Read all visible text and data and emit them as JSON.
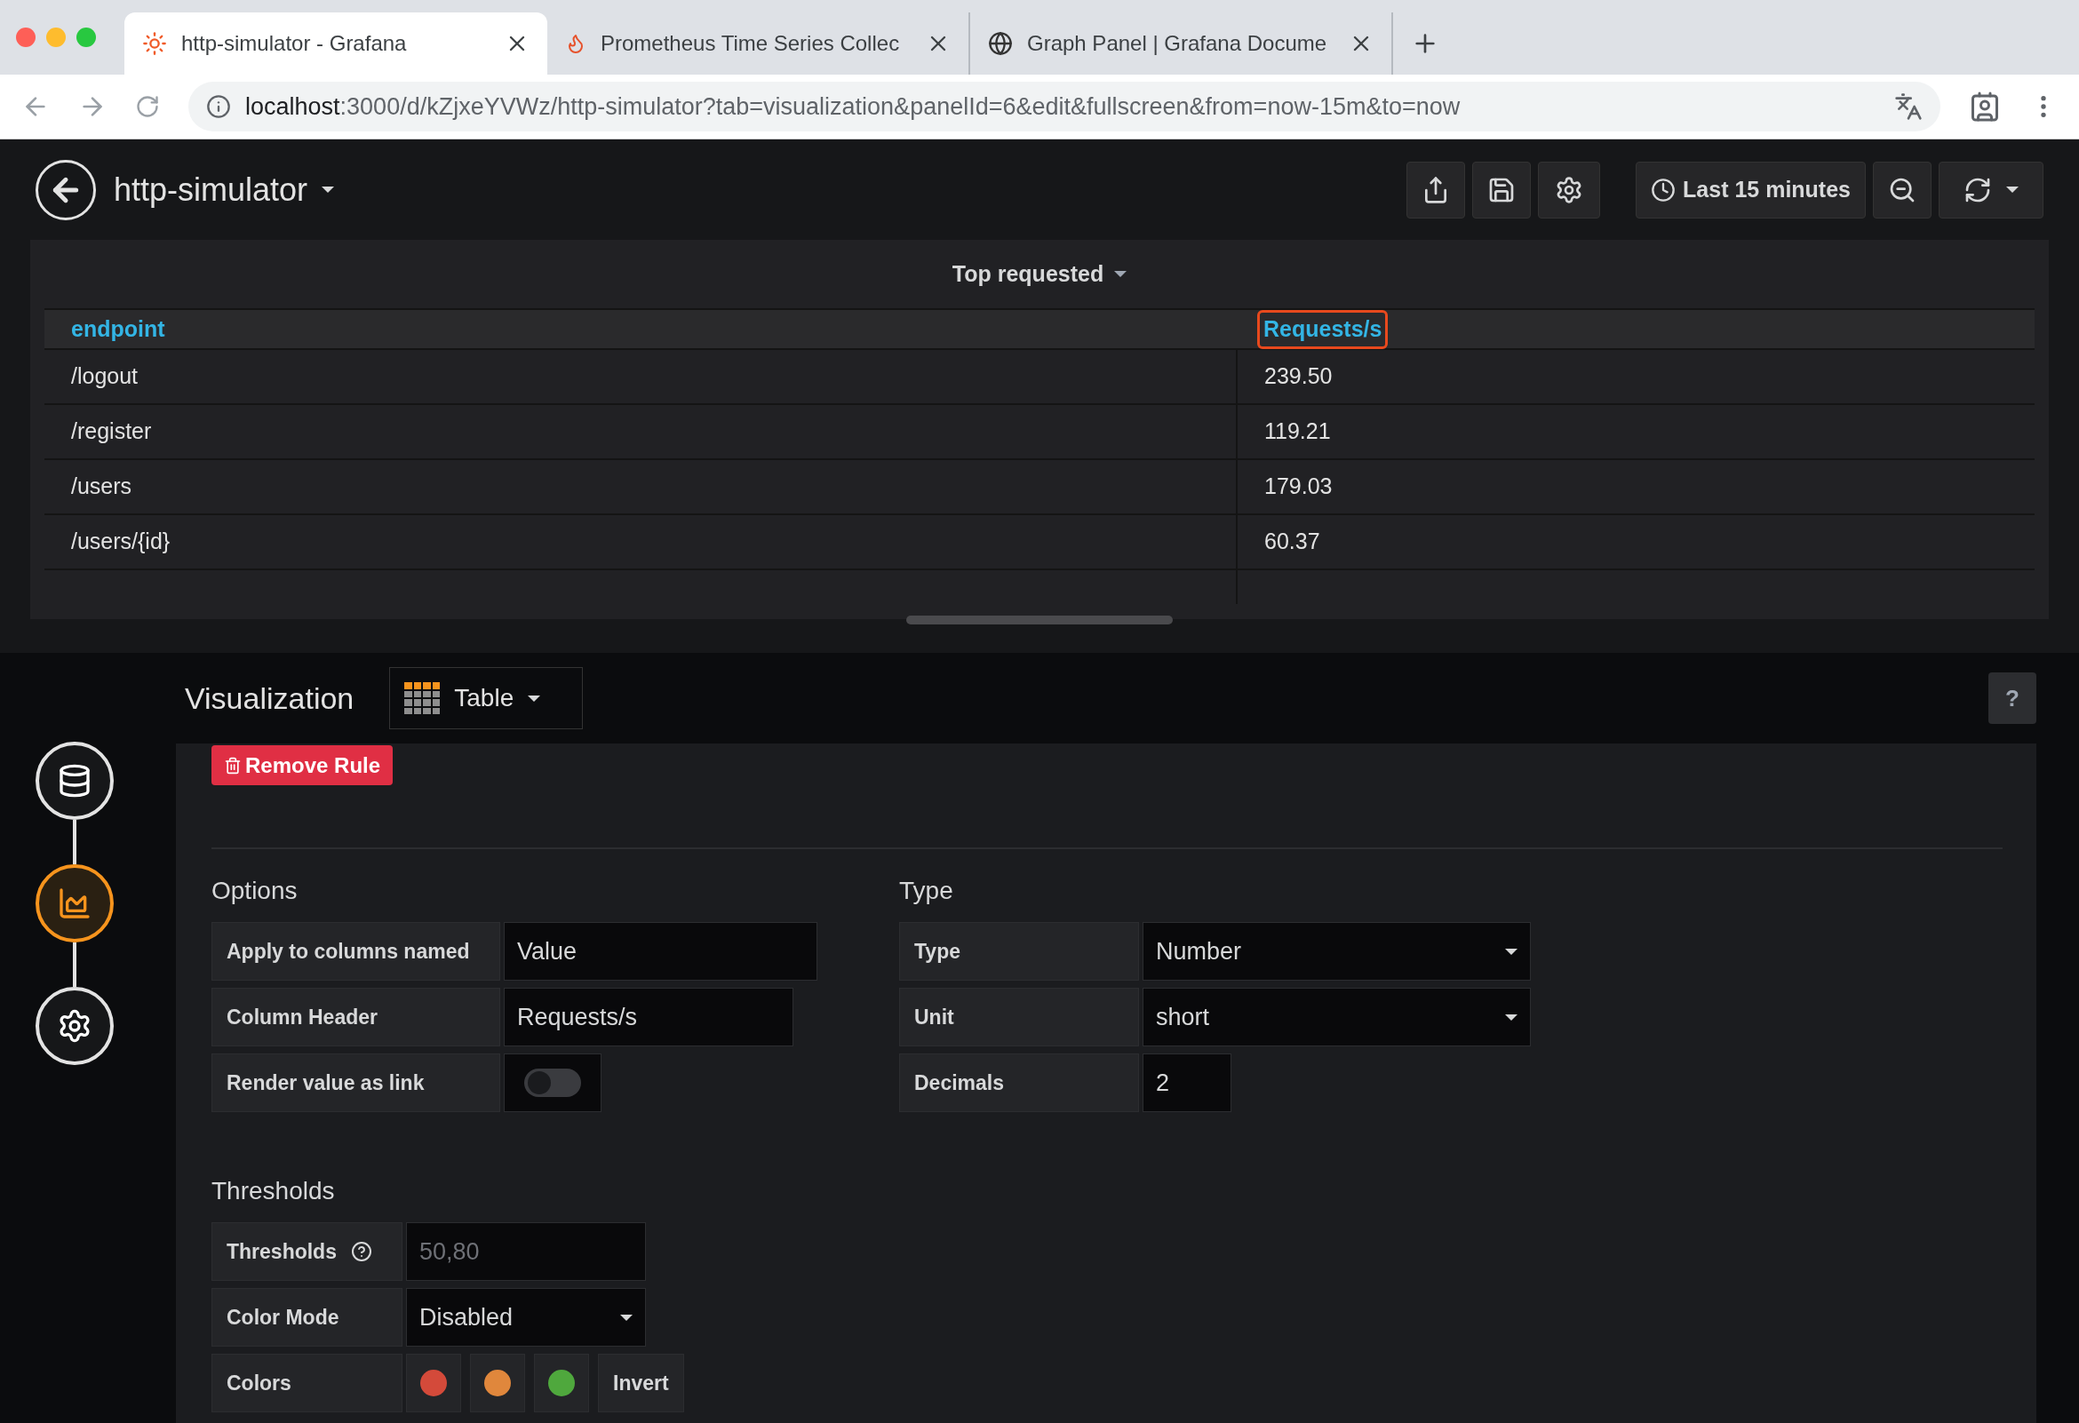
{
  "browser": {
    "tabs": [
      {
        "title": "http-simulator - Grafana",
        "kind": "grafana",
        "selected": true
      },
      {
        "title": "Prometheus Time Series Collec",
        "kind": "prometheus",
        "selected": false
      },
      {
        "title": "Graph Panel | Grafana Docume",
        "kind": "globe",
        "selected": false
      }
    ],
    "url_host": "localhost",
    "url_path": ":3000/d/kZjxeYVWz/http-simulator?tab=visualization&panelId=6&edit&fullscreen&from=now-15m&to=now"
  },
  "dashboard": {
    "title": "http-simulator",
    "time_range": "Last 15 minutes"
  },
  "panel": {
    "title": "Top requested",
    "columns": [
      {
        "label": "endpoint",
        "highlighted": false
      },
      {
        "label": "Requests/s",
        "highlighted": true
      }
    ],
    "rows": [
      [
        "/logout",
        "239.50"
      ],
      [
        "/register",
        "119.21"
      ],
      [
        "/users",
        "179.03"
      ],
      [
        "/users/{id}",
        "60.37"
      ]
    ]
  },
  "editor": {
    "steps": [
      {
        "kind": "queries",
        "selected": false
      },
      {
        "kind": "visualization",
        "selected": true
      },
      {
        "kind": "general",
        "selected": false
      }
    ],
    "title": "Visualization",
    "viz_type": "Table",
    "help_label": "?",
    "remove_rule": "Remove Rule",
    "options": {
      "heading": "Options",
      "fields": [
        {
          "kind": "input",
          "label": "Apply to columns named",
          "value": "Value"
        },
        {
          "kind": "input",
          "label": "Column Header",
          "value": "Requests/s"
        },
        {
          "kind": "switch",
          "label": "Render value as link",
          "on": false
        }
      ]
    },
    "type": {
      "heading": "Type",
      "fields": [
        {
          "kind": "select",
          "label": "Type",
          "value": "Number"
        },
        {
          "kind": "select",
          "label": "Unit",
          "value": "short"
        },
        {
          "kind": "input",
          "label": "Decimals",
          "value": "2"
        }
      ]
    },
    "thresholds": {
      "heading": "Thresholds",
      "fields": [
        {
          "kind": "input",
          "label": "Thresholds",
          "placeholder": "50,80",
          "help": true
        },
        {
          "kind": "select",
          "label": "Color Mode",
          "value": "Disabled"
        },
        {
          "kind": "colors",
          "label": "Colors",
          "colors": [
            {
              "color": "#d44a3a"
            },
            {
              "color": "#e0873c"
            },
            {
              "color": "#4fa83d"
            }
          ],
          "action": "Invert"
        }
      ]
    }
  }
}
